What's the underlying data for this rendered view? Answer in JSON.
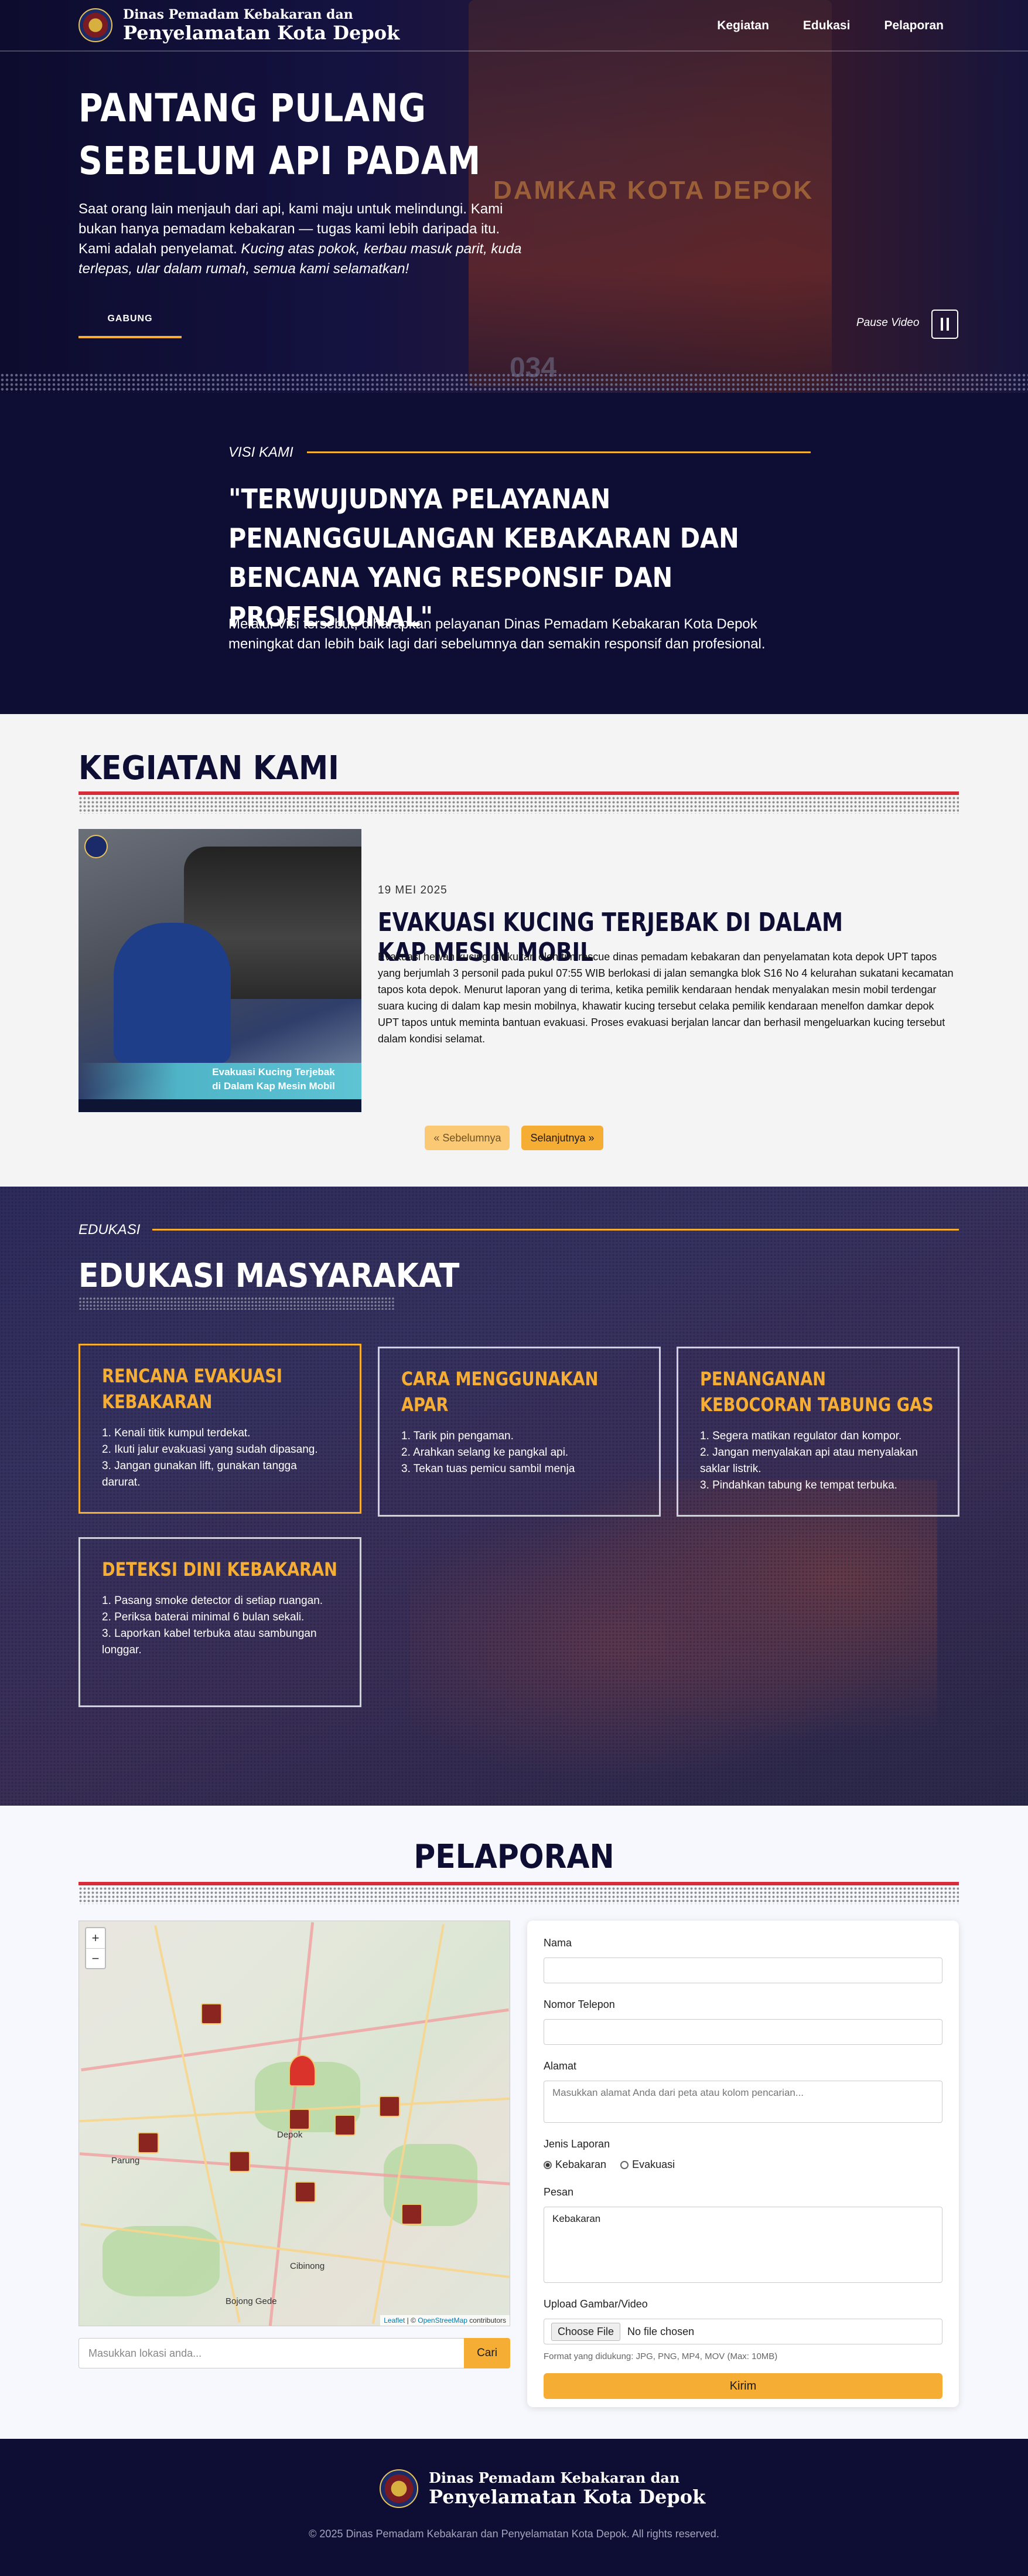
{
  "nav": {
    "brand_line1": "Dinas Pemadam Kebakaran dan",
    "brand_line2": "Penyelamatan Kota Depok",
    "links": [
      "Kegiatan",
      "Edukasi",
      "Pelaporan"
    ]
  },
  "hero": {
    "title_line1": "PANTANG PULANG",
    "title_line2": "SEBELUM API PADAM",
    "text": "Saat orang lain menjauh dari api, kami maju untuk melindungi. Kami bukan hanya pemadam kebakaran — tugas kami lebih daripada itu. Kami adalah penyelamat.",
    "text_italic": "Kucing atas pokok, kerbau masuk parit, kuda terlepas, ular dalam rumah, semua kami selamatkan!",
    "join_button": "GABUNG",
    "pause_label": "Pause Video",
    "truck_sign": "DAMKAR KOTA DEPOK",
    "truck_number": "034"
  },
  "vision": {
    "tag": "VISI KAMI",
    "quote": "\"TERWUJUDNYA PELAYANAN PENANGGULANGAN KEBAKARAN DAN BENCANA YANG RESPONSIF DAN PROFESIONAL\"",
    "text": "Melalui Visi tersebut, diharapkan pelayanan Dinas Pemadam Kebakaran Kota Depok meningkat dan lebih baik lagi dari sebelumnya dan semakin responsif dan profesional."
  },
  "kegiatan": {
    "title": "KEGIATAN KAMI",
    "image_caption_line1": "Evakuasi Kucing Terjebak",
    "image_caption_line2": "di Dalam Kap Mesin Mobil",
    "date": "19 MEI 2025",
    "card_title": "EVAKUASI KUCING TERJEBAK DI DALAM KAP MESIN MOBIL",
    "card_body": "Evakuasi hewan kucing dilakukan oleh tim rescue dinas pemadam kebakaran dan penyelamatan kota depok UPT tapos yang berjumlah 3 personil pada pukul 07:55 WIB berlokasi di jalan semangka blok S16 No 4 kelurahan sukatani kecamatan tapos kota depok. Menurut laporan yang di terima, ketika pemilik kendaraan hendak menyalakan mesin mobil terdengar suara kucing di dalam kap mesin mobilnya, khawatir kucing tersebut celaka pemilik kendaraan menelfon damkar depok UPT tapos untuk meminta bantuan evakuasi. Proses evakuasi berjalan lancar dan berhasil mengeluarkan kucing tersebut dalam kondisi selamat.",
    "prev_label": "« Sebelumnya",
    "next_label": "Selanjutnya »"
  },
  "edukasi": {
    "tag": "EDUKASI",
    "title": "EDUKASI MASYARAKAT",
    "cards": [
      {
        "title": "RENCANA EVAKUASI KEBAKARAN",
        "items": [
          "1. Kenali titik kumpul terdekat.",
          "2. Ikuti jalur evakuasi yang sudah dipasang.",
          "3. Jangan gunakan lift, gunakan tangga darurat."
        ]
      },
      {
        "title": "CARA MENGGUNAKAN APAR",
        "items": [
          "1. Tarik pin pengaman.",
          "2. Arahkan selang ke pangkal api.",
          "3. Tekan tuas pemicu sambil menja"
        ]
      },
      {
        "title": "PENANGANAN KEBOCORAN TABUNG GAS",
        "items": [
          "1. Segera matikan regulator dan kompor.",
          "2. Jangan menyalakan api atau menyalakan saklar listrik.",
          "3. Pindahkan tabung ke tempat terbuka."
        ]
      },
      {
        "title": "DETEKSI DINI KEBAKARAN",
        "items": [
          "1. Pasang smoke detector di setiap ruangan.",
          "2. Periksa baterai minimal 6 bulan sekali.",
          "3. Laporkan kabel terbuka atau sambungan longgar."
        ]
      }
    ]
  },
  "pelaporan": {
    "title": "PELAPORAN",
    "map": {
      "zoom_in": "+",
      "zoom_out": "−",
      "labels": [
        "Depok",
        "Parung",
        "Cibinong",
        "Bojong Gede"
      ],
      "attribution_leaflet": "Leaflet",
      "attribution_sep": " | © ",
      "attribution_osm": "OpenStreetMap",
      "attribution_end": " contributors"
    },
    "search_placeholder": "Masukkan lokasi anda...",
    "search_button": "Cari",
    "form": {
      "name_label": "Nama",
      "phone_label": "Nomor Telepon",
      "address_label": "Alamat",
      "address_placeholder": "Masukkan alamat Anda dari peta atau kolom pencarian...",
      "type_label": "Jenis Laporan",
      "type_options": [
        "Kebakaran",
        "Evakuasi"
      ],
      "message_label": "Pesan",
      "message_value": "Kebakaran",
      "upload_label": "Upload Gambar/Video",
      "file_button": "Choose File",
      "file_status": "No file chosen",
      "hint": "Format yang didukung: JPG, PNG, MP4, MOV (Max: 10MB)",
      "submit": "Kirim"
    }
  },
  "footer": {
    "brand_line1": "Dinas Pemadam Kebakaran dan",
    "brand_line2": "Penyelamatan Kota Depok",
    "copyright": "© 2025 Dinas Pemadam Kebakaran dan Penyelamatan Kota Depok. All rights reserved."
  },
  "colors": {
    "navy": "#0e0d33",
    "accent": "#f6ad34",
    "red": "#d62d3a"
  }
}
